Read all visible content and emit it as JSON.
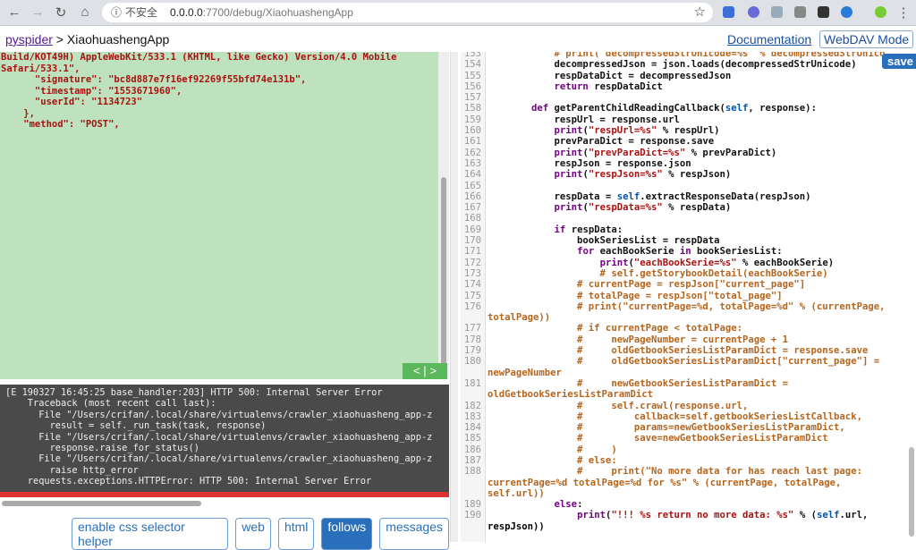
{
  "browser": {
    "url_insecure": "不安全",
    "url_host": "0.0.0.0",
    "url_path": ":7700/debug/XiaohuashengApp",
    "icons": [
      "back-icon",
      "forward-icon",
      "reload-icon",
      "home-icon",
      "info-icon",
      "star-icon"
    ]
  },
  "header": {
    "breadcrumb_root": "pyspider",
    "breadcrumb_sep": " > ",
    "breadcrumb_current": "XiaohuashengApp",
    "documentation": "Documentation",
    "webdav": "WebDAV Mode"
  },
  "request_lines": [
    "Build/KOT49H) AppleWebKit/533.1 (KHTML, like Gecko) Version/4.0 Mobile",
    "Safari/533.1\",",
    "      \"signature\": \"bc8d887e7f16ef92269f55bfd74e131b\",",
    "      \"timestamp\": \"1553671960\",",
    "      \"userId\": \"1134723\"",
    "    },",
    "    \"method\": \"POST\","
  ],
  "pager": {
    "prev": "<",
    "sep": "|",
    "next": ">"
  },
  "log_lines": [
    "[E 190327 16:45:25 base_handler:203] HTTP 500: Internal Server Error",
    "    Traceback (most recent call last):",
    "      File \"/Users/crifan/.local/share/virtualenvs/crawler_xiaohuasheng_app-z",
    "        result = self._run_task(task, response)",
    "      File \"/Users/crifan/.local/share/virtualenvs/crawler_xiaohuasheng_app-z",
    "        response.raise_for_status()",
    "      File \"/Users/crifan/.local/share/virtualenvs/crawler_xiaohuasheng_app-z",
    "        raise http_error",
    "    requests.exceptions.HTTPError: HTTP 500: Internal Server Error"
  ],
  "tabs": [
    {
      "label": "enable css selector helper",
      "active": false
    },
    {
      "label": "web",
      "active": false
    },
    {
      "label": "html",
      "active": false
    },
    {
      "label": "follows",
      "active": true
    },
    {
      "label": "messages",
      "active": false
    }
  ],
  "editor": {
    "save": "save",
    "lines": [
      {
        "n": "153",
        "t": "            # print(\"decompressedStrUnicode=%s\" % decompressedStrUnicode"
      },
      {
        "n": "154",
        "t": "            decompressedJson = json.loads(decompressedStrUnicode)"
      },
      {
        "n": "155",
        "t": "            respDataDict = decompressedJson"
      },
      {
        "n": "156",
        "t": "            return respDataDict"
      },
      {
        "n": "157",
        "t": ""
      },
      {
        "n": "158",
        "t": "        def getParentChildReadingCallback(self, response):"
      },
      {
        "n": "159",
        "t": "            respUrl = response.url"
      },
      {
        "n": "160",
        "t": "            print(\"respUrl=%s\" % respUrl)"
      },
      {
        "n": "161",
        "t": "            prevParaDict = response.save"
      },
      {
        "n": "162",
        "t": "            print(\"prevParaDict=%s\" % prevParaDict)"
      },
      {
        "n": "163",
        "t": "            respJson = response.json"
      },
      {
        "n": "164",
        "t": "            print(\"respJson=%s\" % respJson)"
      },
      {
        "n": "165",
        "t": ""
      },
      {
        "n": "166",
        "t": "            respData = self.extractResponseData(respJson)"
      },
      {
        "n": "167",
        "t": "            print(\"respData=%s\" % respData)"
      },
      {
        "n": "168",
        "t": ""
      },
      {
        "n": "169",
        "t": "            if respData:"
      },
      {
        "n": "170",
        "t": "                bookSeriesList = respData"
      },
      {
        "n": "171",
        "t": "                for eachBookSerie in bookSeriesList:"
      },
      {
        "n": "172",
        "t": "                    print(\"eachBookSerie=%s\" % eachBookSerie)"
      },
      {
        "n": "173",
        "t": "                    # self.getStorybookDetail(eachBookSerie)"
      },
      {
        "n": "174",
        "t": "                # currentPage = respJson[\"current_page\"]"
      },
      {
        "n": "175",
        "t": "                # totalPage = respJson[\"total_page\"]"
      },
      {
        "n": "176",
        "t": "                # print(\"currentPage=%d, totalPage=%d\" % (currentPage,",
        "w": "totalPage))"
      },
      {
        "n": "177",
        "t": "                # if currentPage < totalPage:"
      },
      {
        "n": "178",
        "t": "                #     newPageNumber = currentPage + 1"
      },
      {
        "n": "179",
        "t": "                #     oldGetbookSeriesListParamDict = response.save"
      },
      {
        "n": "180",
        "t": "                #     oldGetbookSeriesListParamDict[\"current_page\"] =",
        "w": "newPageNumber"
      },
      {
        "n": "181",
        "t": "                #     newGetbookSeriesListParamDict =",
        "w": "oldGetbookSeriesListParamDict"
      },
      {
        "n": "182",
        "t": "                #     self.crawl(response.url,"
      },
      {
        "n": "183",
        "t": "                #         callback=self.getbookSeriesListCallback,"
      },
      {
        "n": "184",
        "t": "                #         params=newGetbookSeriesListParamDict,"
      },
      {
        "n": "185",
        "t": "                #         save=newGetbookSeriesListParamDict"
      },
      {
        "n": "186",
        "t": "                #     )"
      },
      {
        "n": "187",
        "t": "                # else:"
      },
      {
        "n": "188",
        "t": "                #     print(\"No more data for has reach last page:",
        "w": "currentPage=%d totalPage=%d for %s\" % (currentPage, totalPage,",
        "w2": "self.url))"
      },
      {
        "n": "189",
        "t": "            else:"
      },
      {
        "n": "190",
        "t": "                print(\"!!! %s return no more data: %s\" % (self.url,",
        "w": "respJson))"
      }
    ]
  },
  "colors": {
    "request_bg": "#bde2bd",
    "log_bg": "#4a4a4a",
    "error_line": "#dd3333",
    "accent": "#2a6fbb"
  }
}
